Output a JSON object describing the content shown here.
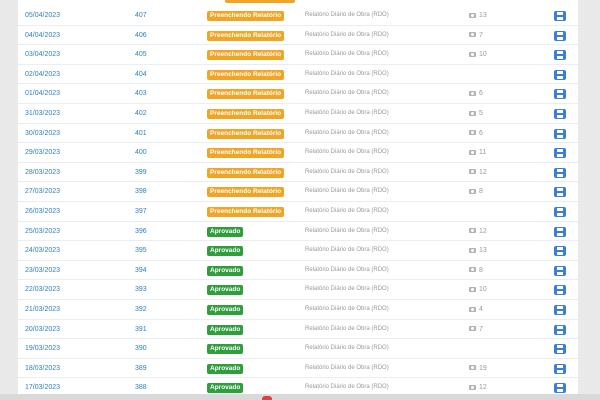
{
  "table": {
    "report_label": "Relatório Diário de Obra (RDO)",
    "rows": [
      {
        "date": "05/04/2023",
        "number": "407",
        "status": "Preenchendo Relatório",
        "status_type": "warn",
        "photos": "13"
      },
      {
        "date": "04/04/2023",
        "number": "406",
        "status": "Preenchendo Relatório",
        "status_type": "warn",
        "photos": "7"
      },
      {
        "date": "03/04/2023",
        "number": "405",
        "status": "Preenchendo Relatório",
        "status_type": "warn",
        "photos": "10"
      },
      {
        "date": "02/04/2023",
        "number": "404",
        "status": "Preenchendo Relatório",
        "status_type": "warn",
        "photos": ""
      },
      {
        "date": "01/04/2023",
        "number": "403",
        "status": "Preenchendo Relatório",
        "status_type": "warn",
        "photos": "6"
      },
      {
        "date": "31/03/2023",
        "number": "402",
        "status": "Preenchendo Relatório",
        "status_type": "warn",
        "photos": "5"
      },
      {
        "date": "30/03/2023",
        "number": "401",
        "status": "Preenchendo Relatório",
        "status_type": "warn",
        "photos": "6"
      },
      {
        "date": "29/03/2023",
        "number": "400",
        "status": "Preenchendo Relatório",
        "status_type": "warn",
        "photos": "11"
      },
      {
        "date": "28/03/2023",
        "number": "399",
        "status": "Preenchendo Relatório",
        "status_type": "warn",
        "photos": "12"
      },
      {
        "date": "27/03/2023",
        "number": "398",
        "status": "Preenchendo Relatório",
        "status_type": "warn",
        "photos": "8"
      },
      {
        "date": "26/03/2023",
        "number": "397",
        "status": "Preenchendo Relatório",
        "status_type": "warn",
        "photos": ""
      },
      {
        "date": "25/03/2023",
        "number": "396",
        "status": "Aprovado",
        "status_type": "ok",
        "photos": "12"
      },
      {
        "date": "24/03/2023",
        "number": "395",
        "status": "Aprovado",
        "status_type": "ok",
        "photos": "13"
      },
      {
        "date": "23/03/2023",
        "number": "394",
        "status": "Aprovado",
        "status_type": "ok",
        "photos": "8"
      },
      {
        "date": "22/03/2023",
        "number": "393",
        "status": "Aprovado",
        "status_type": "ok",
        "photos": "10"
      },
      {
        "date": "21/03/2023",
        "number": "392",
        "status": "Aprovado",
        "status_type": "ok",
        "photos": "4"
      },
      {
        "date": "20/03/2023",
        "number": "391",
        "status": "Aprovado",
        "status_type": "ok",
        "photos": "7"
      },
      {
        "date": "19/03/2023",
        "number": "390",
        "status": "Aprovado",
        "status_type": "ok",
        "photos": ""
      },
      {
        "date": "18/03/2023",
        "number": "389",
        "status": "Aprovado",
        "status_type": "ok",
        "photos": "19"
      },
      {
        "date": "17/03/2023",
        "number": "388",
        "status": "Aprovado",
        "status_type": "ok",
        "photos": "12"
      }
    ]
  },
  "icons": {
    "photo": "camera-icon",
    "print": "print-icon"
  },
  "colors": {
    "link": "#2e7fc1",
    "warn_badge": "#f0a524",
    "ok_badge": "#2f9e3d",
    "print_button": "#3d7fd4"
  }
}
